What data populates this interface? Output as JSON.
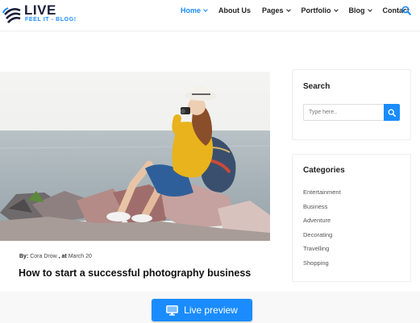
{
  "brand": {
    "name": "LIVE",
    "tagline": "FEEL IT - BLOG!",
    "accent": "#1a8cff"
  },
  "nav": {
    "items": [
      {
        "label": "Home",
        "active": true,
        "dropdown": true
      },
      {
        "label": "About Us",
        "active": false,
        "dropdown": false
      },
      {
        "label": "Pages",
        "active": false,
        "dropdown": true
      },
      {
        "label": "Portfolio",
        "active": false,
        "dropdown": true
      },
      {
        "label": "Blog",
        "active": false,
        "dropdown": true
      },
      {
        "label": "Contact",
        "active": false,
        "dropdown": false
      }
    ],
    "search_icon": "search-icon"
  },
  "post": {
    "author_prefix": "By:",
    "author": "Cora Drow",
    "date_prefix": ", at",
    "date": "March 20",
    "title": "How to start a successful photography business"
  },
  "sidebar": {
    "search": {
      "title": "Search",
      "placeholder": "Type here..",
      "button_icon": "search-icon"
    },
    "categories": {
      "title": "Categories",
      "items": [
        "Entertainment",
        "Business",
        "Adventure",
        "Decorating",
        "Travelling",
        "Shopping"
      ]
    }
  },
  "preview": {
    "label": "Live preview",
    "icon": "monitor-icon"
  }
}
